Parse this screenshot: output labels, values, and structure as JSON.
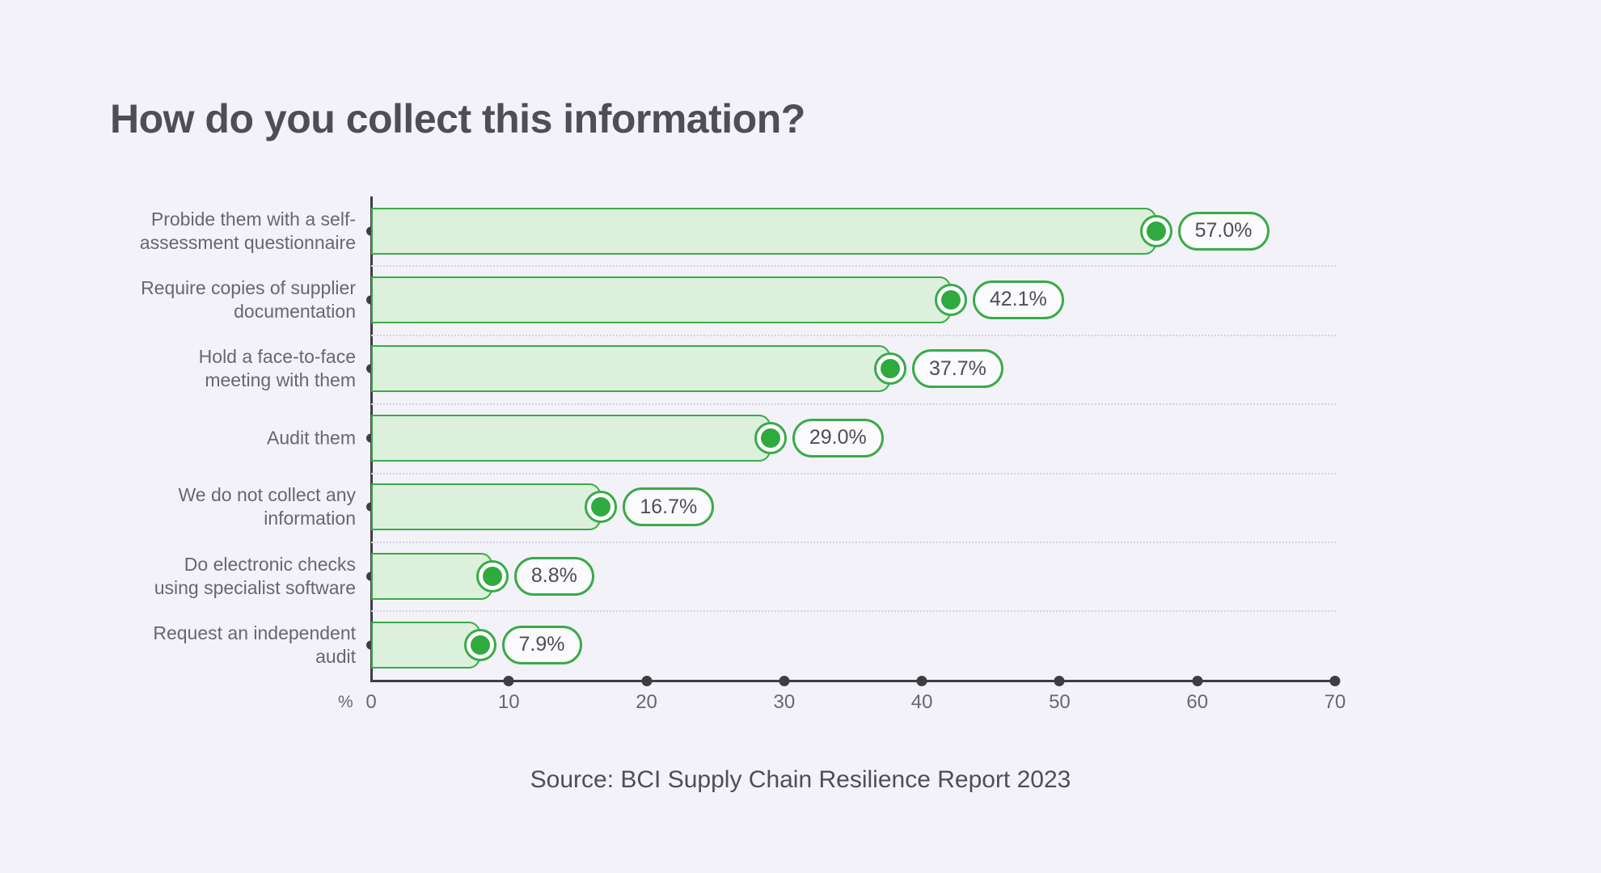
{
  "title": "How do you collect this information?",
  "source": "Source: BCI Supply Chain Resilience Report 2023",
  "unit_label": "%",
  "colors": {
    "background": "#f3f2f8",
    "bar_fill": "#ddf0db",
    "bar_stroke": "#39ab48",
    "marker_fill": "#2faa3f",
    "title_text": "#4e4e54",
    "label_text": "#67676d",
    "axis": "#3d3d42",
    "gridline": "#d4d3dd"
  },
  "chart_data": {
    "type": "bar",
    "orientation": "horizontal",
    "title": "How do you collect this information?",
    "xlabel": "%",
    "ylabel": "",
    "xlim": [
      0,
      70
    ],
    "xticks": [
      0,
      10,
      20,
      30,
      40,
      50,
      60,
      70
    ],
    "xtick_labels": [
      "0",
      "10",
      "20",
      "30",
      "40",
      "50",
      "60",
      "70"
    ],
    "grid": "dotted-horizontal-separators",
    "legend": "none",
    "categories": [
      "Probide them with a self-assessment questionnaire",
      "Require copies of supplier documentation",
      "Hold a face-to-face meeting with them",
      "Audit them",
      "We do not collect any information",
      "Do electronic checks using specialist software",
      "Request an independent audit"
    ],
    "values": [
      57.0,
      42.1,
      37.7,
      29.0,
      16.7,
      8.8,
      7.9
    ],
    "value_labels": [
      "57.0%",
      "42.1%",
      "37.7%",
      "29.0%",
      "16.7%",
      "8.8%",
      "7.9%"
    ]
  },
  "rows": [
    {
      "label_line1": "Probide them with a self-",
      "label_line2": "assessment questionnaire",
      "value": 57.0,
      "value_label": "57.0%"
    },
    {
      "label_line1": "Require copies of supplier",
      "label_line2": "documentation",
      "value": 42.1,
      "value_label": "42.1%"
    },
    {
      "label_line1": "Hold a face-to-face",
      "label_line2": "meeting with them",
      "value": 37.7,
      "value_label": "37.7%"
    },
    {
      "label_line1": "Audit them",
      "label_line2": "",
      "value": 29.0,
      "value_label": "29.0%"
    },
    {
      "label_line1": "We do not collect any",
      "label_line2": "information",
      "value": 16.7,
      "value_label": "16.7%"
    },
    {
      "label_line1": "Do electronic checks",
      "label_line2": "using specialist software",
      "value": 8.8,
      "value_label": "8.8%"
    },
    {
      "label_line1": "Request an independent",
      "label_line2": "audit",
      "value": 7.9,
      "value_label": "7.9%"
    }
  ],
  "xaxis": {
    "ticks": [
      {
        "value": 0,
        "label": "0"
      },
      {
        "value": 10,
        "label": "10"
      },
      {
        "value": 20,
        "label": "20"
      },
      {
        "value": 30,
        "label": "30"
      },
      {
        "value": 40,
        "label": "40"
      },
      {
        "value": 50,
        "label": "50"
      },
      {
        "value": 60,
        "label": "60"
      },
      {
        "value": 70,
        "label": "70"
      }
    ]
  }
}
